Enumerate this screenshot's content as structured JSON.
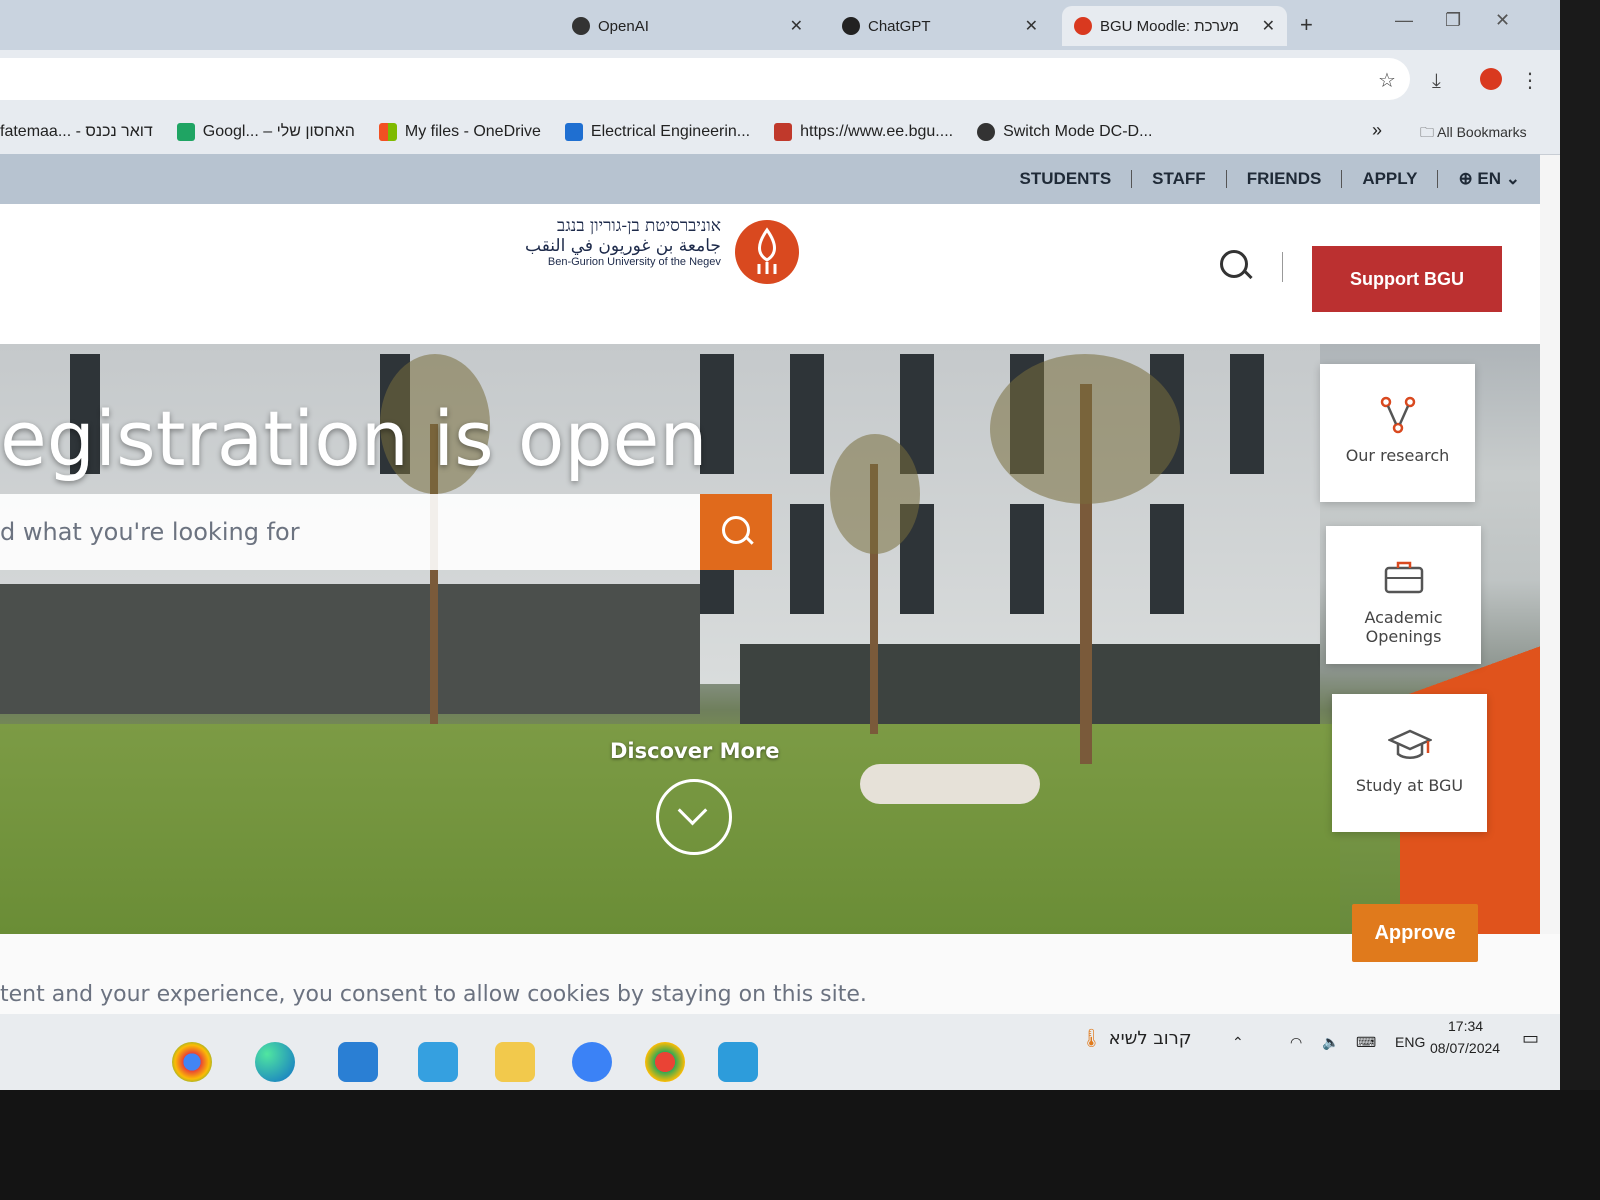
{
  "browser": {
    "tabs": [
      {
        "label": "OpenAI",
        "active": false
      },
      {
        "label": "ChatGPT",
        "active": false
      },
      {
        "label": "BGU Moodle: מערכת",
        "active": true
      }
    ],
    "new_tab": "+",
    "window_controls": [
      "—",
      "❐",
      "✕"
    ]
  },
  "bookmarks": [
    {
      "label": "fatemaa... - דואר נכנס"
    },
    {
      "label": "Googl... – האחסון שלי"
    },
    {
      "label": "My files - OneDrive"
    },
    {
      "label": "Electrical Engineerin..."
    },
    {
      "label": "https://www.ee.bgu...."
    },
    {
      "label": "Switch Mode DC-D..."
    }
  ],
  "bookmarks_more": "»",
  "all_bookmarks": "All Bookmarks",
  "site": {
    "topnav": [
      "STUDENTS",
      "STAFF",
      "FRIENDS",
      "APPLY"
    ],
    "language": "EN",
    "logo": {
      "hebrew": "אוניברסיטת בן-גוריון בנגב",
      "arabic": "جامعة بن غوريون في النقب",
      "english": "Ben-Gurion University of the Negev"
    },
    "support_button": "Support BGU",
    "hero": {
      "headline": "egistration is open",
      "search_placeholder": "d what you're looking for",
      "discover": "Discover More"
    },
    "cards": [
      {
        "label": "Our research",
        "icon": "network-icon"
      },
      {
        "label": "Academic Openings",
        "icon": "briefcase-icon"
      },
      {
        "label": "Study at BGU",
        "icon": "graduation-cap-icon"
      }
    ],
    "cookie": {
      "text": "tent and your experience, you consent to allow cookies by staying on this site.",
      "approve": "Approve"
    }
  },
  "taskbar": {
    "weather": "קרוב לשיא",
    "language": "ENG",
    "time": "17:34",
    "date": "08/07/2024"
  },
  "colors": {
    "brand_red": "#bb3030",
    "brand_orange": "#e06a1c",
    "accent_orange": "#e0531c"
  }
}
